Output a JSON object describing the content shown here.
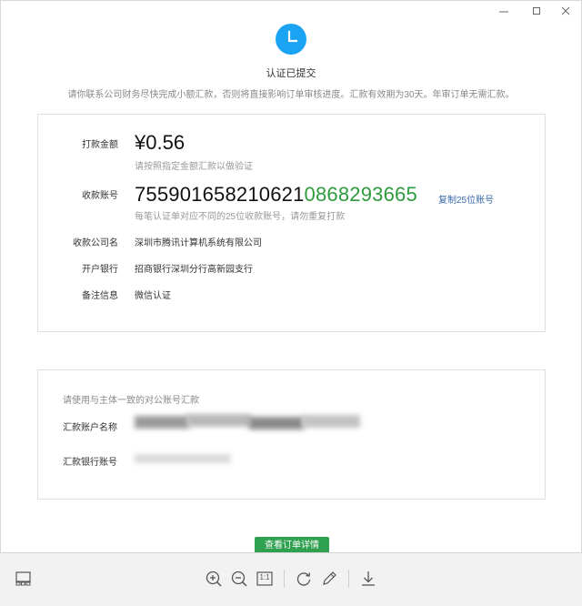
{
  "window": {
    "controls": [
      "minimize",
      "maximize",
      "close"
    ]
  },
  "status": {
    "icon": "clock-icon",
    "title": "认证已提交",
    "description": "请你联系公司财务尽快完成小额汇款，否则将直接影响订单审核进度。汇款有效期为30天。年审订单无需汇款。",
    "accent_color": "#1aa3f2"
  },
  "payment": {
    "amount_label": "打款金额",
    "amount_value": "¥0.56",
    "amount_note": "请按照指定金额汇款以做验证",
    "account_label": "收款账号",
    "account_prefix": "755901658210621",
    "account_suffix": "0868293665",
    "copy_link": "复制25位账号",
    "account_note": "每笔认证单对应不同的25位收款账号，请勿重复打款",
    "company_label": "收款公司名",
    "company_value": "深圳市腾讯计算机系统有限公司",
    "bank_label": "开户银行",
    "bank_value": "招商银行深圳分行高新园支行",
    "remark_label": "备注信息",
    "remark_value": "微信认证"
  },
  "sender": {
    "title": "请使用与主体一致的对公账号汇款",
    "name_label": "汇款账户名称",
    "account_label": "汇款银行账号"
  },
  "cta": {
    "label": "查看订单详情",
    "color": "#2ea04f"
  },
  "toolbar": {
    "items": [
      "layout-icon",
      "zoom-in-icon",
      "zoom-out-icon",
      "actual-size-icon",
      "rotate-icon",
      "edit-icon",
      "download-icon"
    ],
    "actual_size_label": "1:1"
  }
}
